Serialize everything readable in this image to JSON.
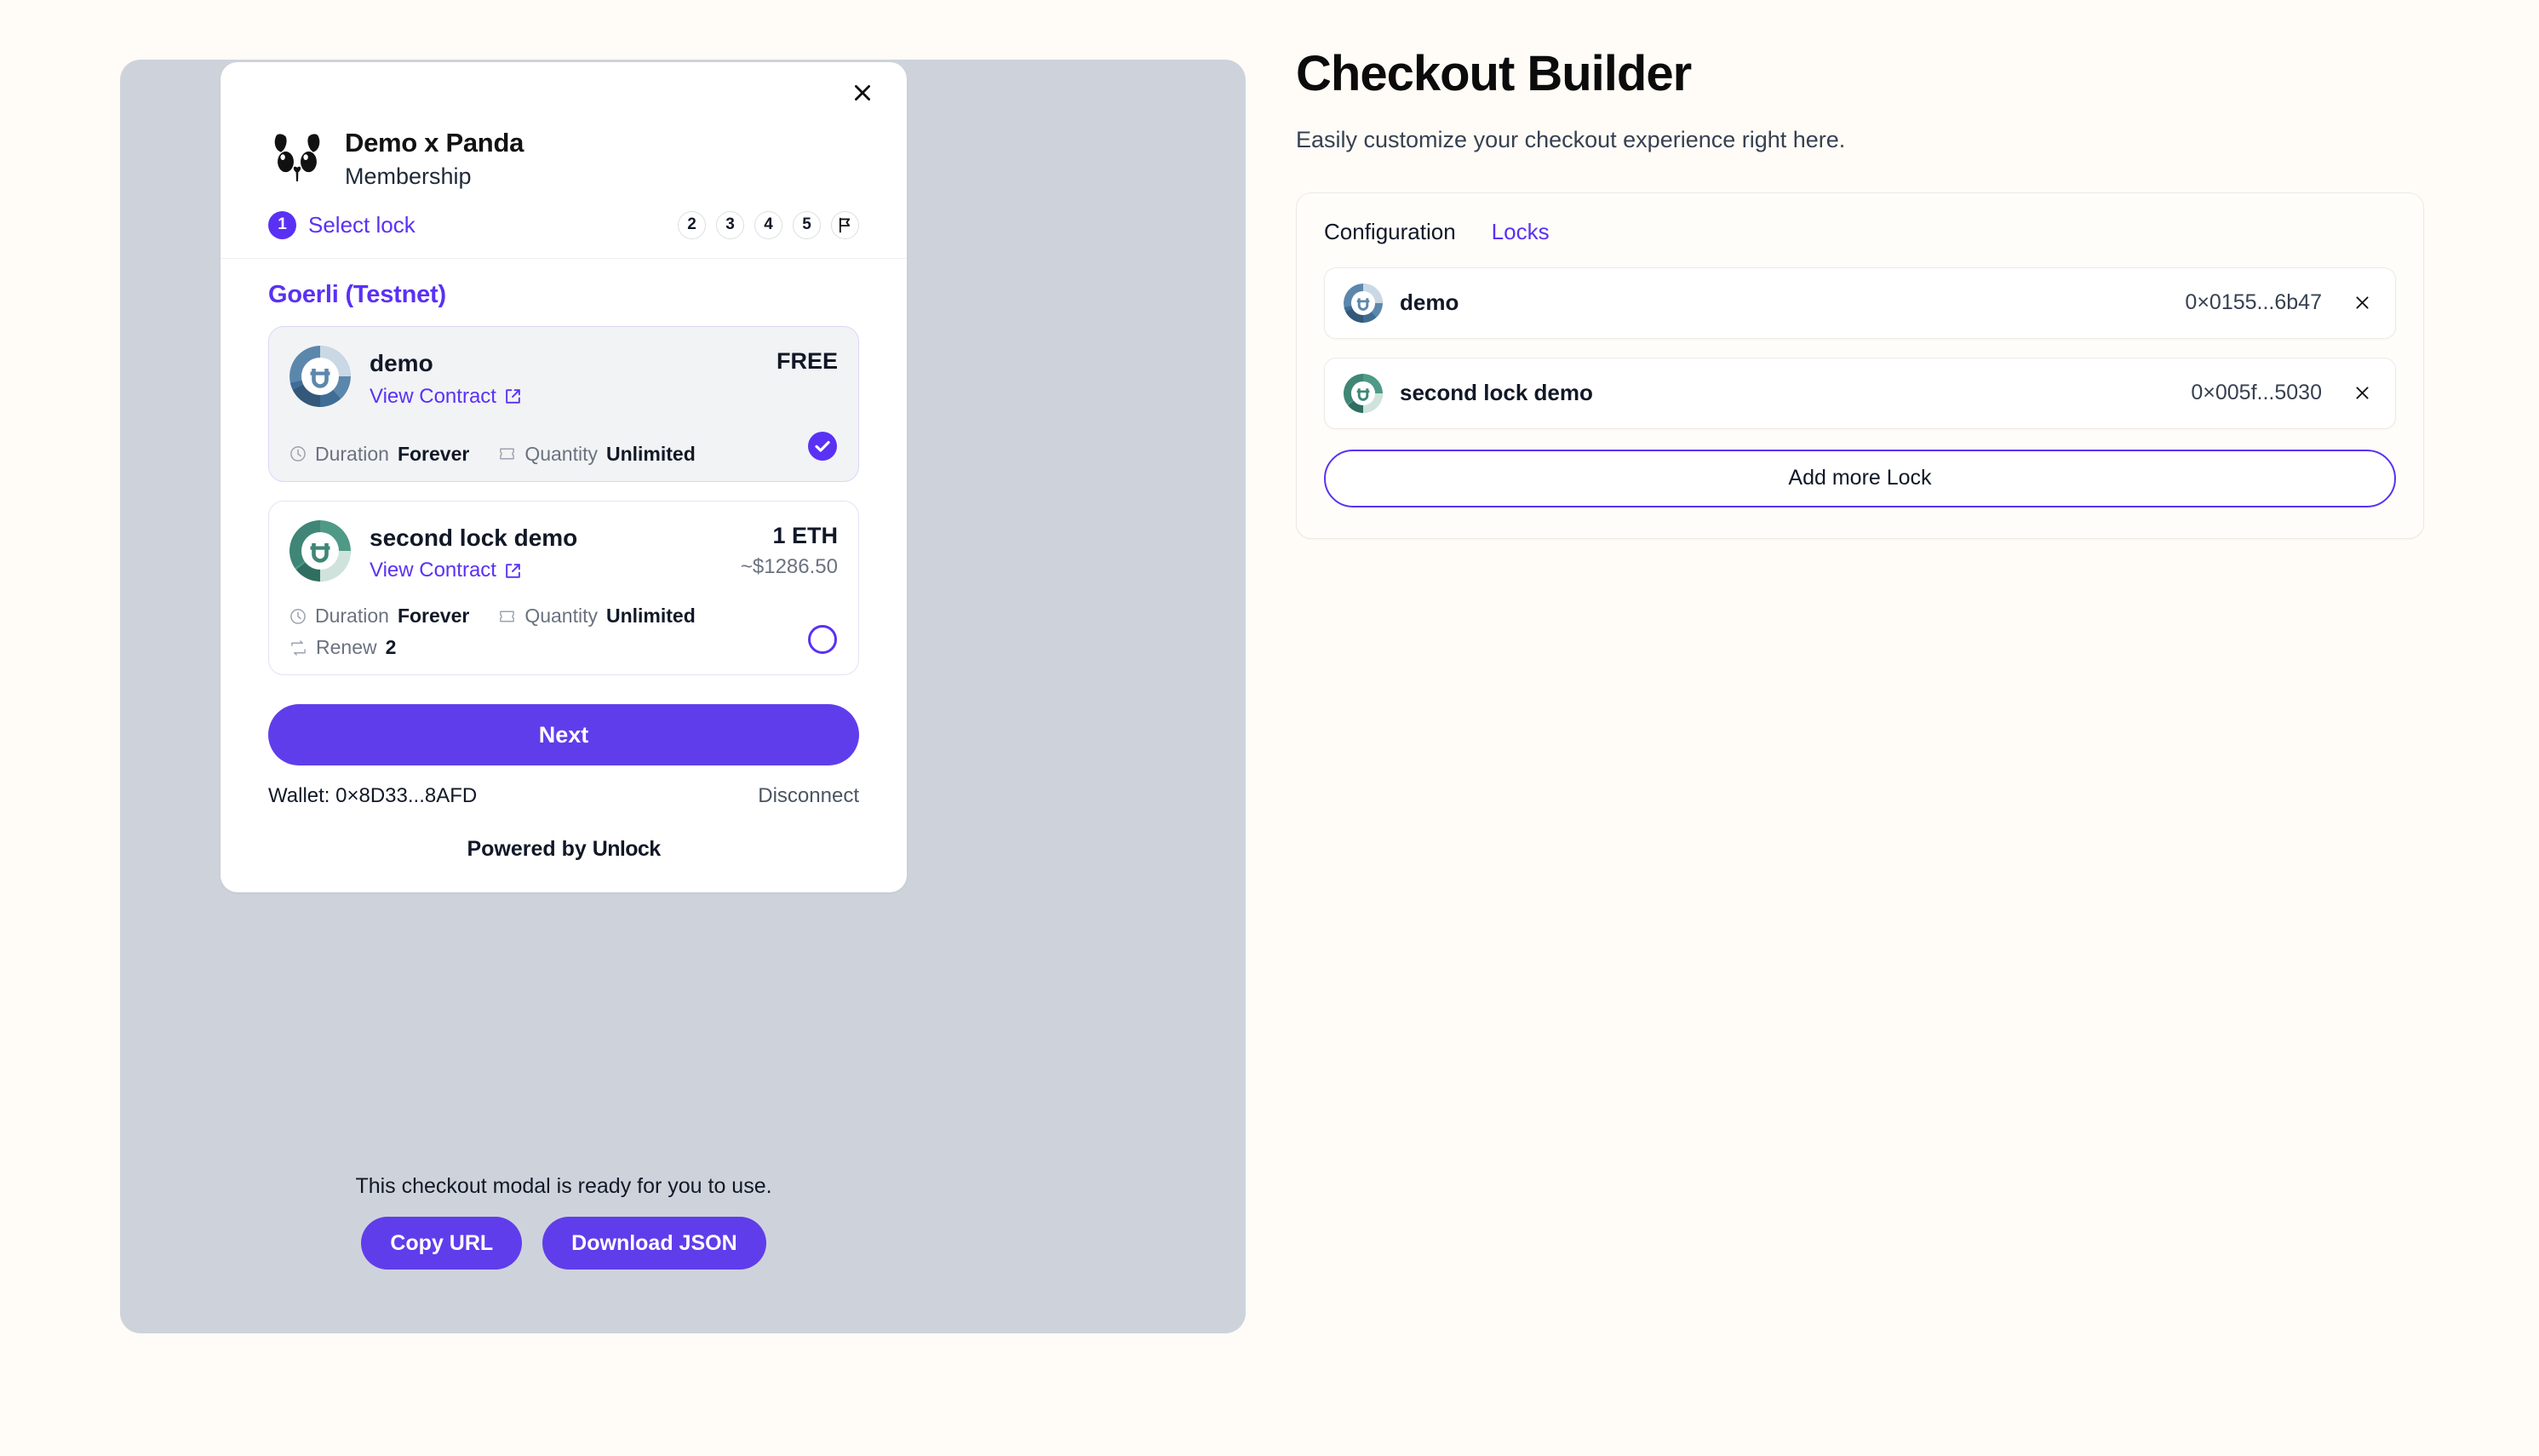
{
  "theme": {
    "page_bg": "#FFFCF7",
    "preview_bg": "#CED3DB",
    "accent": "#5A31F4",
    "button_purple": "#603DEB",
    "selected_card_bg": "#F2F3F5"
  },
  "checkout_modal": {
    "close_icon": "close-icon",
    "brand": {
      "logo_icon": "panda-logo",
      "title": "Demo x Panda",
      "subtitle": "Membership"
    },
    "steps": {
      "current": {
        "number": "1",
        "label": "Select lock"
      },
      "others": [
        "2",
        "3",
        "4",
        "5"
      ],
      "flag_icon": "flag-icon"
    },
    "network_label": "Goerli (Testnet)",
    "locks": [
      {
        "name": "demo",
        "view_contract_label": "View Contract",
        "external_link_icon": "external-link-icon",
        "price_main": "FREE",
        "price_sub": "",
        "avatar_colors": {
          "ring_dark": "#3F6D96",
          "ring_mid": "#5C87AC",
          "ring_light": "#C9D8E4",
          "ring_deep": "#34587A"
        },
        "meta": [
          {
            "icon": "clock-icon",
            "label": "Duration",
            "value": "Forever"
          },
          {
            "icon": "ticket-icon",
            "label": "Quantity",
            "value": "Unlimited"
          }
        ],
        "selected": true,
        "indicator_icon": "check-circle-filled-icon"
      },
      {
        "name": "second lock demo",
        "view_contract_label": "View Contract",
        "external_link_icon": "external-link-icon",
        "price_main": "1 ETH",
        "price_sub": "~$1286.50",
        "avatar_colors": {
          "ring_dark": "#3F8676",
          "ring_mid": "#4E9A87",
          "ring_light": "#CFE3DC",
          "ring_deep": "#2F6E60"
        },
        "meta": [
          {
            "icon": "clock-icon",
            "label": "Duration",
            "value": "Forever"
          },
          {
            "icon": "ticket-icon",
            "label": "Quantity",
            "value": "Unlimited"
          },
          {
            "icon": "renew-icon",
            "label": "Renew",
            "value": "2"
          }
        ],
        "selected": false,
        "indicator_icon": "radio-empty-icon"
      }
    ],
    "next_label": "Next",
    "wallet_label": "Wallet: 0×8D33...8AFD",
    "disconnect_label": "Disconnect",
    "powered_by_prefix": "Powered by",
    "powered_by_brand": "Unlock"
  },
  "preview_footer": {
    "ready_text": "This checkout modal is ready for you to use.",
    "copy_url_label": "Copy URL",
    "download_json_label": "Download JSON"
  },
  "builder": {
    "title": "Checkout Builder",
    "subtitle": "Easily customize your checkout experience right here.",
    "tabs": [
      {
        "label": "Configuration",
        "active": false
      },
      {
        "label": "Locks",
        "active": true
      }
    ],
    "lock_rows": [
      {
        "name": "demo",
        "address": "0×0155...6b47",
        "remove_icon": "close-icon"
      },
      {
        "name": "second lock demo",
        "address": "0×005f...5030",
        "remove_icon": "close-icon"
      }
    ],
    "add_lock_label": "Add more Lock"
  }
}
